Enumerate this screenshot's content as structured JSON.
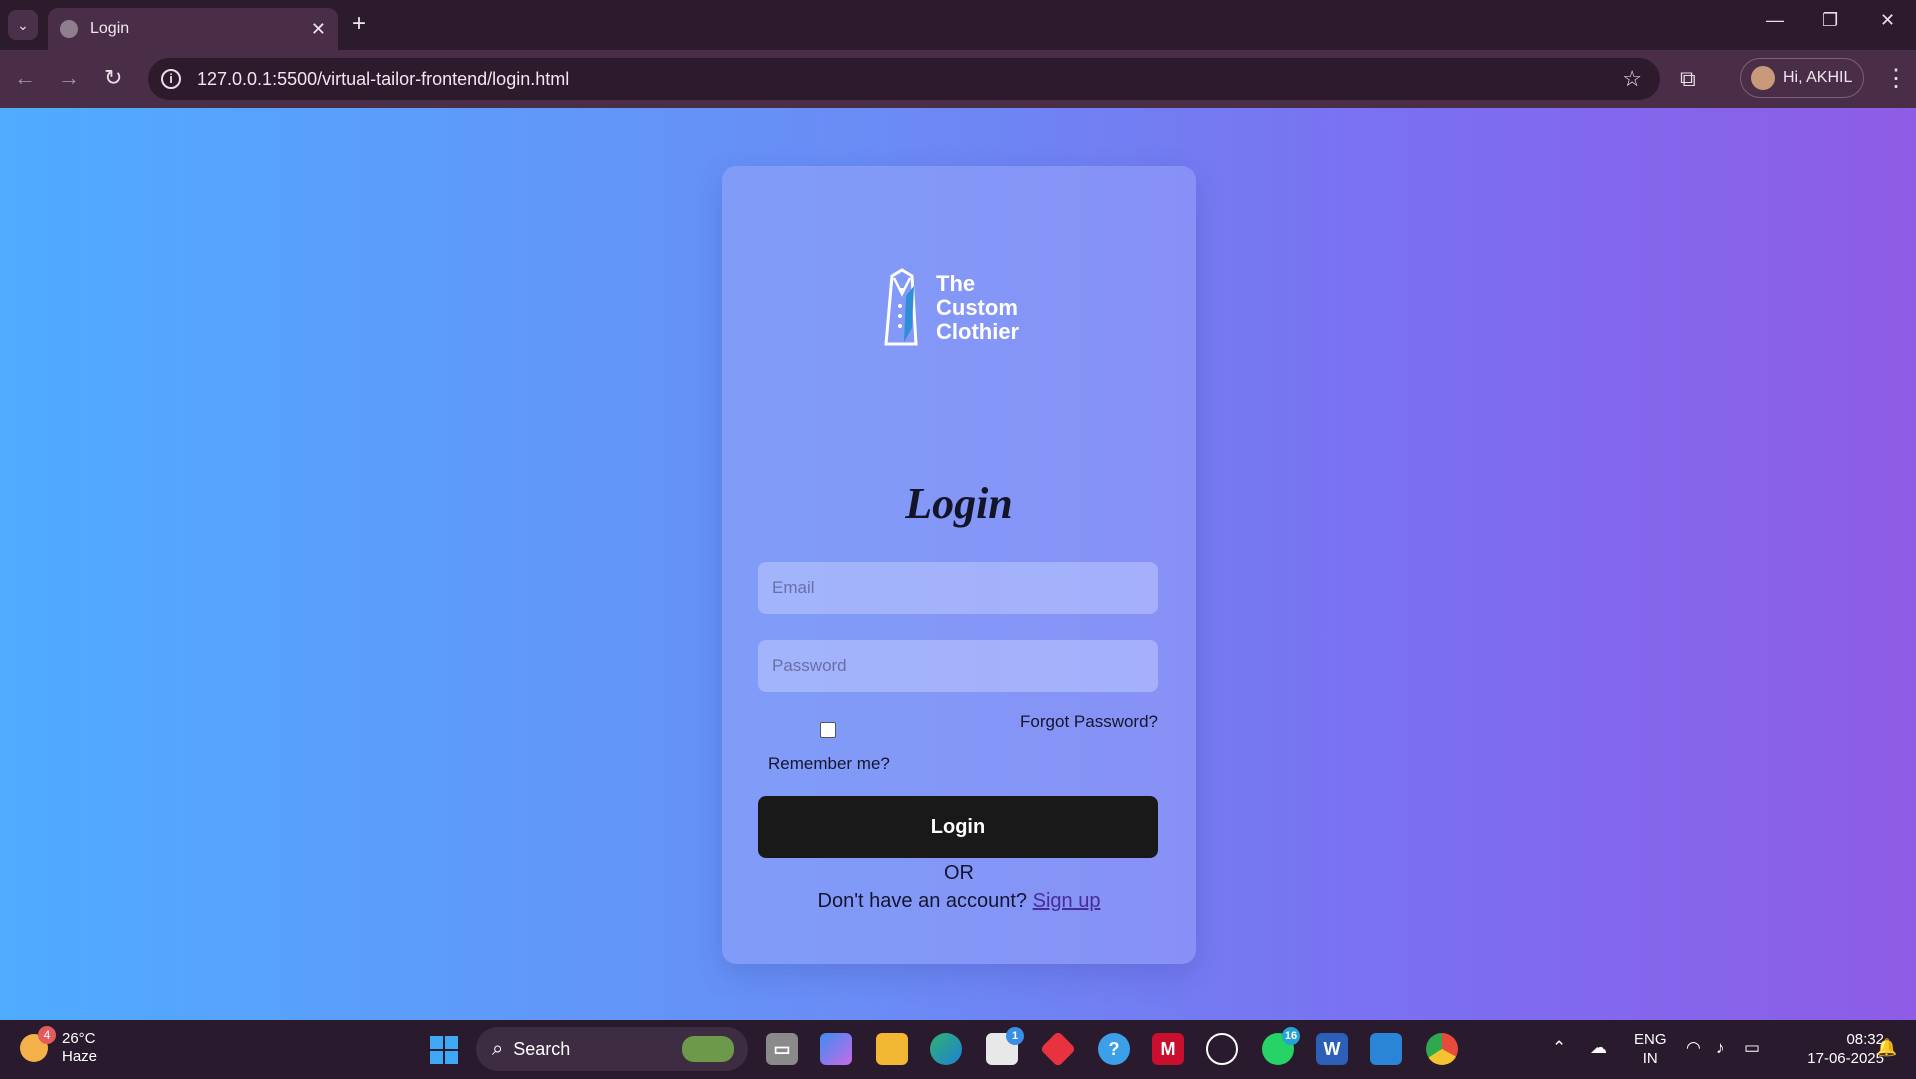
{
  "browser": {
    "tab_title": "Login",
    "url": "127.0.0.1:5500/virtual-tailor-frontend/login.html",
    "profile_label": "Hi, AKHIL"
  },
  "brand": {
    "logo_lines": [
      "The",
      "Custom",
      "Clothier"
    ]
  },
  "form": {
    "heading": "Login",
    "email_placeholder": "Email",
    "password_placeholder": "Password",
    "remember_label": "Remember me?",
    "forgot_label": "Forgot Password?",
    "login_button": "Login",
    "or_text": "OR",
    "signup_prompt": "Don't have an account?",
    "signup_link": "Sign up"
  },
  "colors": {
    "gradient_start": "#4facfe",
    "gradient_end": "#8e5ce6",
    "button_bg": "#191919"
  },
  "taskbar": {
    "weather_badge": "4",
    "temperature": "26°C",
    "condition": "Haze",
    "search_label": "Search",
    "store_badge": "1",
    "whatsapp_badge": "16",
    "lang_line1": "ENG",
    "lang_line2": "IN",
    "time": "08:32",
    "date": "17-06-2025"
  }
}
